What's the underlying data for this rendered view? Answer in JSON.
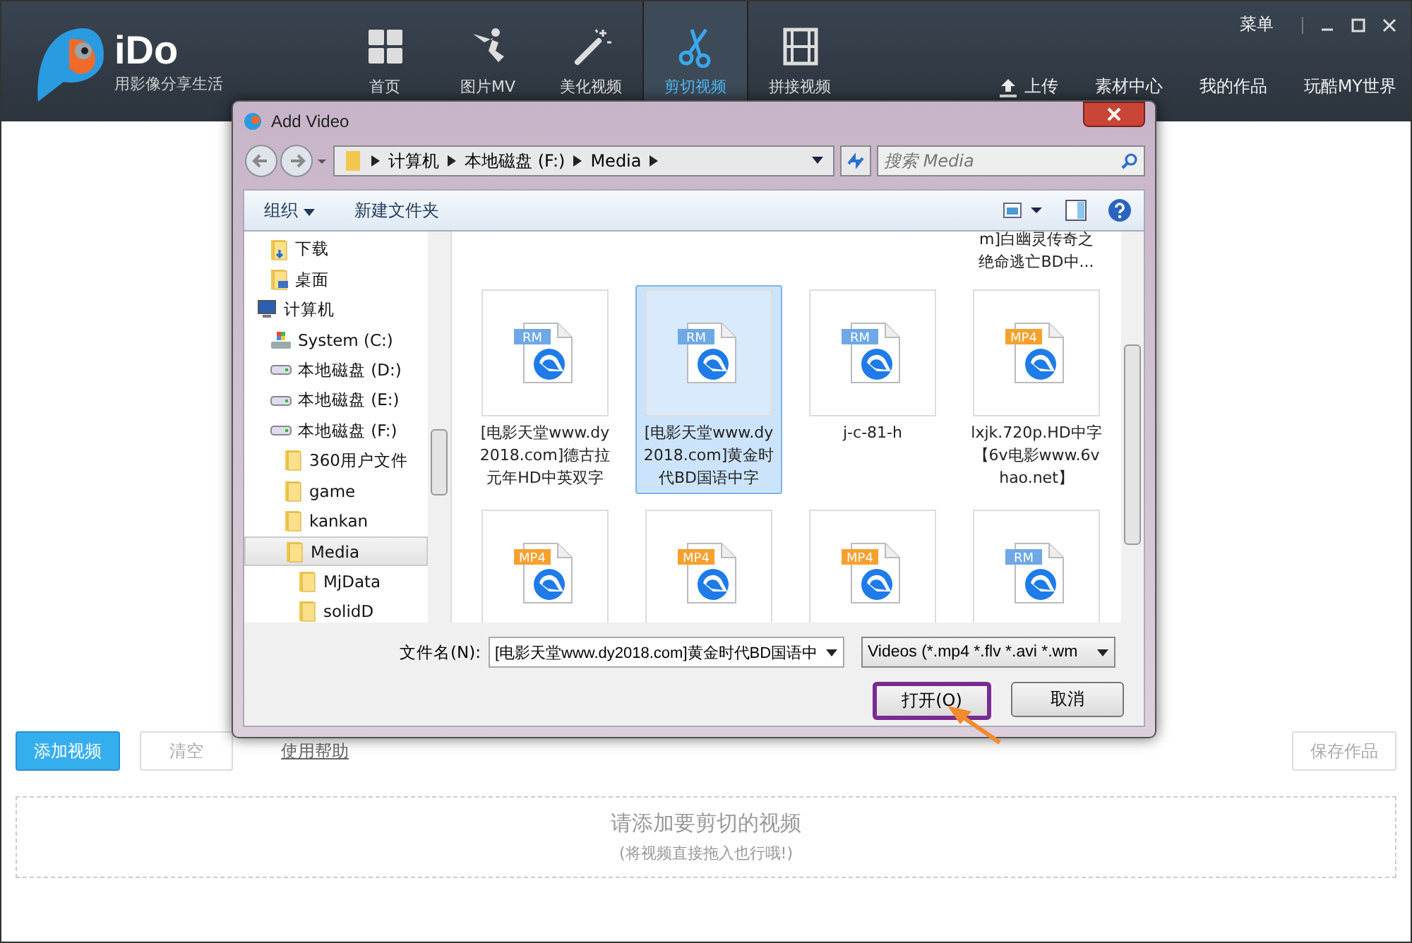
{
  "app": {
    "logo": "iDo",
    "slogan": "用影像分享生活",
    "tabs": [
      {
        "label": "首页",
        "selected": false
      },
      {
        "label": "图片MV",
        "selected": false
      },
      {
        "label": "美化视频",
        "selected": false
      },
      {
        "label": "剪切视频",
        "selected": true
      },
      {
        "label": "拼接视频",
        "selected": false
      }
    ],
    "menu": "菜单",
    "links": [
      {
        "label": "上传",
        "kind": "upload"
      },
      {
        "label": "素材中心",
        "kind": "plain"
      },
      {
        "label": "我的作品",
        "kind": "plain"
      },
      {
        "label": "玩酷MY世界",
        "kind": "plain"
      }
    ]
  },
  "toolbar": {
    "add": "添加视频",
    "clear": "清空",
    "help": "使用帮助",
    "save": "保存作品"
  },
  "dropzone": {
    "title": "请添加要剪切的视频",
    "hint": "(将视频直接拖入也行哦!)"
  },
  "dialog": {
    "title": "Add Video",
    "breadcrumb": [
      "计算机",
      "本地磁盘 (F:)",
      "Media"
    ],
    "search_placeholder": "搜索 Media",
    "organize": "组织",
    "new_folder": "新建文件夹",
    "tree": [
      {
        "label": "下载",
        "kind": "download",
        "selected": false
      },
      {
        "label": "桌面",
        "kind": "desktop",
        "selected": false
      },
      {
        "label": "计算机",
        "kind": "computer",
        "selected": false,
        "children": [
          {
            "label": "System (C:)",
            "kind": "system",
            "selected": false
          },
          {
            "label": "本地磁盘 (D:)",
            "kind": "drive",
            "selected": false
          },
          {
            "label": "本地磁盘 (E:)",
            "kind": "drive",
            "selected": false
          },
          {
            "label": "本地磁盘 (F:)",
            "kind": "drive",
            "selected": false,
            "children": [
              {
                "label": "360用户文件",
                "kind": "folder",
                "selected": false
              },
              {
                "label": "game",
                "kind": "folder",
                "selected": false
              },
              {
                "label": "kankan",
                "kind": "folder",
                "selected": false
              },
              {
                "label": "Media",
                "kind": "folder",
                "selected": true,
                "children": [
                  {
                    "label": "MjData",
                    "kind": "folder",
                    "selected": false
                  },
                  {
                    "label": "solidD",
                    "kind": "folder",
                    "selected": false
                  }
                ]
              }
            ]
          }
        ]
      }
    ],
    "partial_label": "m]白幽灵传奇之绝命逃亡BD中...",
    "files": [
      {
        "tag": "RM",
        "name": "[电影天堂www.dy2018.com]德古拉元年HD中英双字",
        "selected": false
      },
      {
        "tag": "RM",
        "name": "[电影天堂www.dy2018.com]黄金时代BD国语中字",
        "selected": true
      },
      {
        "tag": "RM",
        "name": "j-c-81-h",
        "selected": false
      },
      {
        "tag": "MP4",
        "name": "lxjk.720p.HD中字【6v电影www.6vhao.net】",
        "selected": false
      },
      {
        "tag": "MP4",
        "selected": false
      },
      {
        "tag": "MP4",
        "selected": false
      },
      {
        "tag": "MP4",
        "selected": false
      },
      {
        "tag": "RM",
        "selected": false
      }
    ],
    "filename_label": "文件名(N):",
    "filename": "[电影天堂www.dy2018.com]黄金时代BD国语中",
    "filetype": "Videos (*.mp4 *.flv *.avi *.wm",
    "open": {
      "label": "打开(O)",
      "highlighted": true
    },
    "cancel": "取消"
  }
}
